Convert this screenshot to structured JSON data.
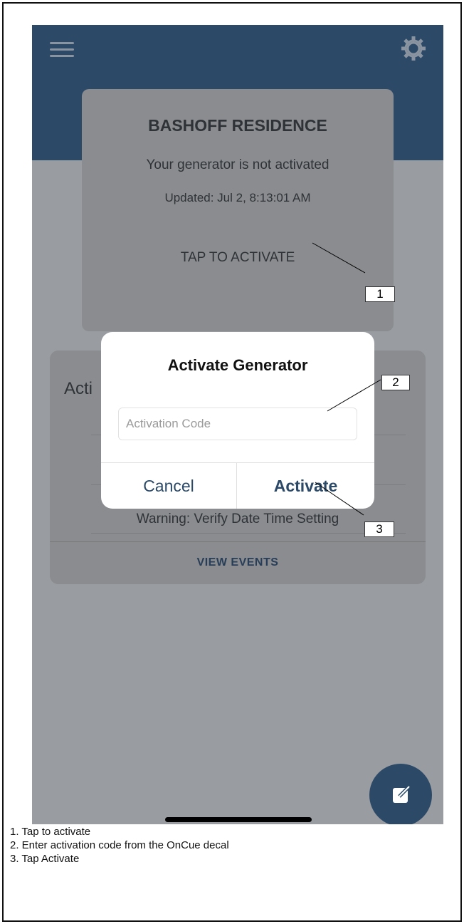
{
  "header": {
    "menu_icon": "hamburger-menu-icon",
    "settings_icon": "gear-icon"
  },
  "status_card": {
    "title": "BASHOFF RESIDENCE",
    "status": "Your generator is not activated",
    "updated": "Updated: Jul 2, 8:13:01 AM",
    "tap_to_activate": "TAP TO ACTIVATE"
  },
  "events_card": {
    "heading": "Acti",
    "warning": "Warning: Verify Date Time Setting",
    "view_events": "VIEW EVENTS"
  },
  "dialog": {
    "title": "Activate Generator",
    "input_placeholder": "Activation Code",
    "cancel_label": "Cancel",
    "activate_label": "Activate"
  },
  "fab": {
    "icon": "edit-icon"
  },
  "callouts": [
    "1",
    "2",
    "3"
  ],
  "captions": [
    "1. Tap to activate",
    "2. Enter activation code from the OnCue decal",
    "3. Tap Activate"
  ],
  "colors": {
    "header_blue": "#2c4a68",
    "overlay_gray": "#999da1",
    "card_gray": "#8a8c8f",
    "accent": "#2c4a68"
  }
}
